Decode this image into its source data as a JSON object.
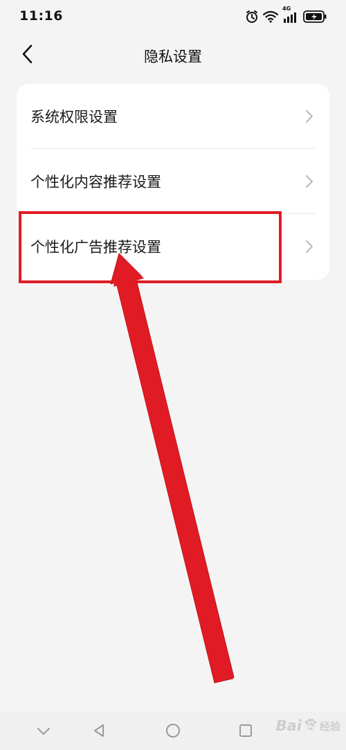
{
  "status_bar": {
    "time": "11:16",
    "network": "4G",
    "icons": [
      "alarm-icon",
      "wifi-icon",
      "signal-icon",
      "battery-charging-icon"
    ]
  },
  "header": {
    "title": "隐私设置",
    "back_icon": "chevron-left-icon"
  },
  "settings_list": {
    "items": [
      {
        "label": "系统权限设置",
        "icon": "chevron-right-icon"
      },
      {
        "label": "个性化内容推荐设置",
        "icon": "chevron-right-icon"
      },
      {
        "label": "个性化广告推荐设置",
        "icon": "chevron-right-icon",
        "highlighted": true
      }
    ]
  },
  "annotation": {
    "color": "#e01b24",
    "type": "red-arrow-and-box"
  },
  "nav_bar": {
    "icons": [
      "chevron-down-icon",
      "back-triangle-icon",
      "home-circle-icon",
      "recents-square-icon"
    ]
  },
  "watermark": {
    "brand": "Bai",
    "brand_end": "经验"
  },
  "colors": {
    "background": "#f4f4f4",
    "card": "#ffffff",
    "highlight": "#e01b24",
    "text": "#1a1a1a",
    "chevron": "#b8b8b8"
  }
}
